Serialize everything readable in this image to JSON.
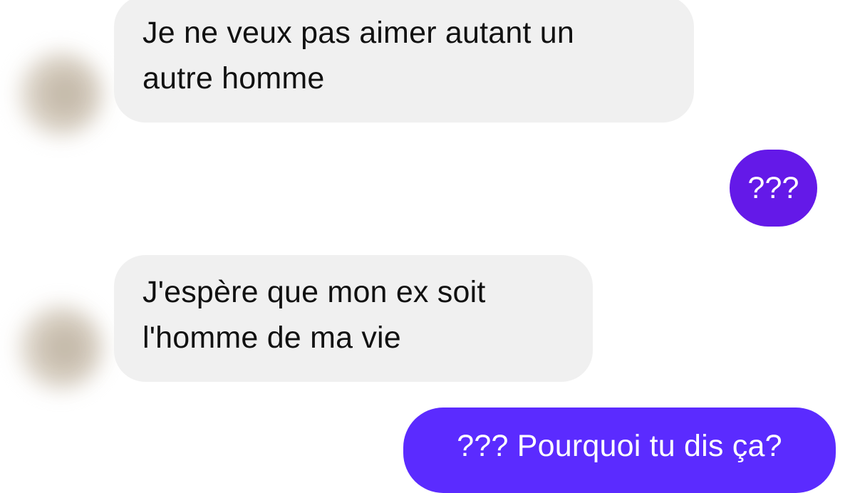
{
  "conversation": {
    "messages": [
      {
        "direction": "incoming",
        "lines": [
          "Je ne veux pas aimer autant un",
          "autre homme"
        ]
      },
      {
        "direction": "outgoing",
        "lines": [
          "???"
        ]
      },
      {
        "direction": "incoming",
        "lines": [
          "J'espère que mon ex soit",
          "l'homme de ma vie"
        ]
      },
      {
        "direction": "outgoing",
        "lines": [
          "??? Pourquoi tu dis ça?"
        ]
      }
    ]
  },
  "colors": {
    "incoming_bubble": "#f0f0f0",
    "outgoing_bubble_1": "#6419e8",
    "outgoing_bubble_2": "#5b2bff",
    "incoming_text": "#111111",
    "outgoing_text": "#ffffff"
  }
}
